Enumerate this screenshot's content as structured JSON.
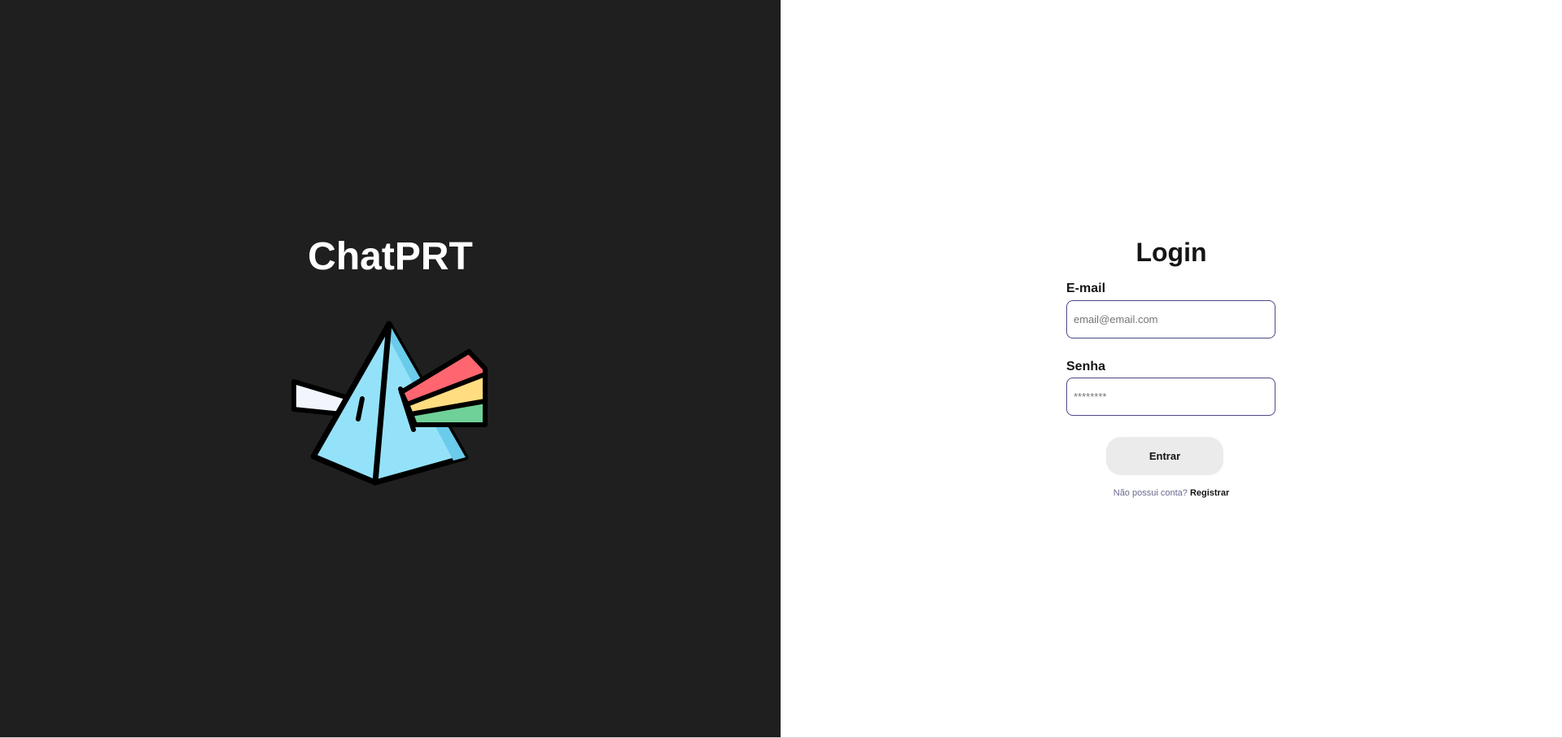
{
  "brand": {
    "title": "ChatPRT",
    "logo_icon": "prism-rainbow-logo-icon",
    "background_color": "#1f1f1f"
  },
  "login": {
    "title": "Login",
    "email": {
      "label": "E-mail",
      "placeholder": "email@email.com",
      "value": ""
    },
    "password": {
      "label": "Senha",
      "placeholder": "********",
      "value": ""
    },
    "submit_label": "Entrar",
    "register_prompt": "Não possui conta?",
    "register_link": "Registrar"
  },
  "colors": {
    "input_border": "#4b4a86",
    "button_bg": "#ebebeb",
    "prism_fill": "#94e2f9",
    "beam_white": "#f2f6fc",
    "beam_red": "#ff6670",
    "beam_yellow": "#ffdd80",
    "beam_green": "#6fd198"
  }
}
